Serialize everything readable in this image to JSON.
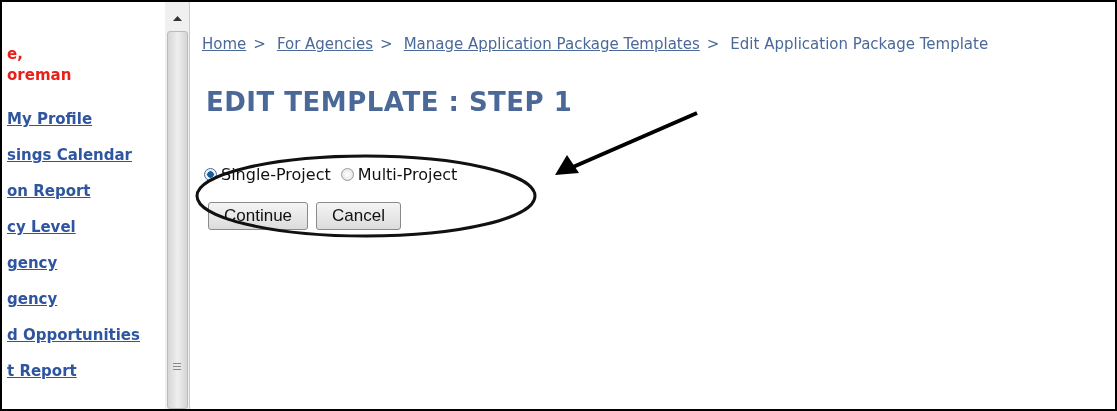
{
  "sidebar": {
    "user_name": [
      "e,",
      "oreman"
    ],
    "links": [
      "My Profile",
      "sings Calendar",
      "on Report",
      "cy Level",
      "gency",
      "gency",
      "d Opportunities",
      "t Report"
    ]
  },
  "breadcrumb": {
    "links": [
      "Home",
      "For Agencies",
      "Manage Application Package Templates"
    ],
    "separator": ">",
    "current": "Edit Application Package Template"
  },
  "heading": "EDIT TEMPLATE : STEP 1",
  "project_type": [
    {
      "label": "Single-Project",
      "selected": true
    },
    {
      "label": "Multi-Project",
      "selected": false
    }
  ],
  "buttons": [
    "Continue",
    "Cancel"
  ]
}
